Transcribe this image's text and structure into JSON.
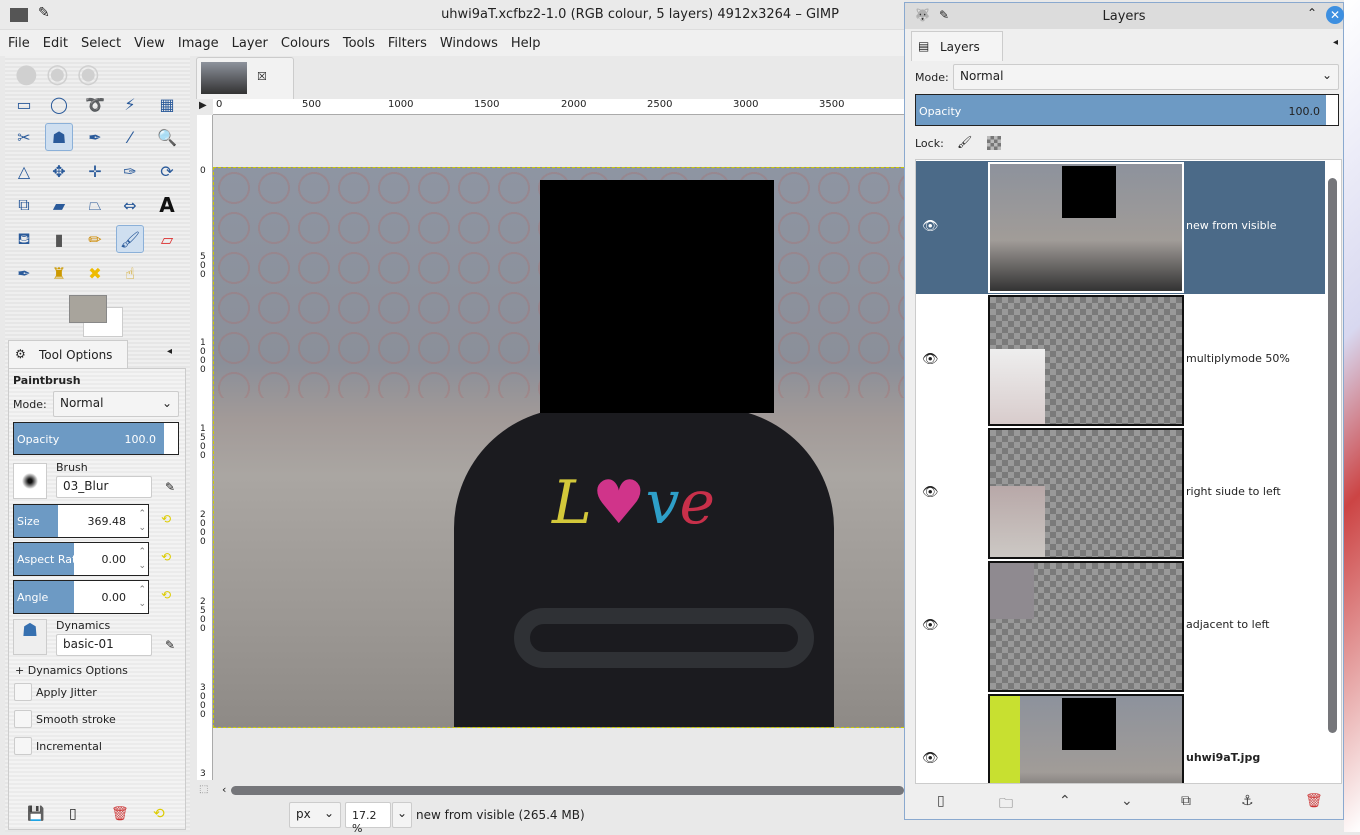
{
  "window": {
    "title": "uhwi9aT.xcfbz2-1.0 (RGB colour, 5 layers) 4912x3264 – GIMP"
  },
  "menu": [
    "File",
    "Edit",
    "Select",
    "View",
    "Image",
    "Layer",
    "Colours",
    "Tools",
    "Filters",
    "Windows",
    "Help"
  ],
  "ruler": {
    "h": [
      "0",
      "500",
      "1000",
      "1500",
      "2000",
      "2500",
      "3000",
      "3500"
    ],
    "v": [
      "0",
      "5 0 0",
      "1 0 0 0",
      "1 5 0 0",
      "2 0 0 0",
      "2 5 0 0",
      "3 0 0 0",
      "3"
    ]
  },
  "tool_options": {
    "tab": "Tool Options",
    "tool": "Paintbrush",
    "mode_label": "Mode:",
    "mode": "Normal",
    "opacity_label": "Opacity",
    "opacity": "100.0",
    "opacity_pct": 100,
    "brush_label": "Brush",
    "brush": "03_Blur",
    "size_label": "Size",
    "size": "369.48",
    "aspect_label": "Aspect Ratio",
    "aspect": "0.00",
    "angle_label": "Angle",
    "angle": "0.00",
    "dynamics_label": "Dynamics",
    "dynamics": "basic-01",
    "dynamics_options": "Dynamics Options",
    "apply_jitter": "Apply Jitter",
    "smooth_stroke": "Smooth stroke",
    "incremental": "Incremental"
  },
  "status": {
    "unit": "px",
    "zoom": "17.2 %",
    "info": "new from visible (265.4 MB)"
  },
  "layers": {
    "title": "Layers",
    "tab": "Layers",
    "mode_label": "Mode:",
    "mode": "Normal",
    "opacity_label": "Opacity",
    "opacity": "100.0",
    "lock_label": "Lock:",
    "items": [
      {
        "name": "new from visible"
      },
      {
        "name": "multiplymode 50%"
      },
      {
        "name": "right siude to left"
      },
      {
        "name": "adjacent to left"
      },
      {
        "name": "uhwi9aT.jpg"
      }
    ]
  },
  "colors": {
    "accent": "#6d9ac4",
    "selected_row": "#4b6a88"
  }
}
